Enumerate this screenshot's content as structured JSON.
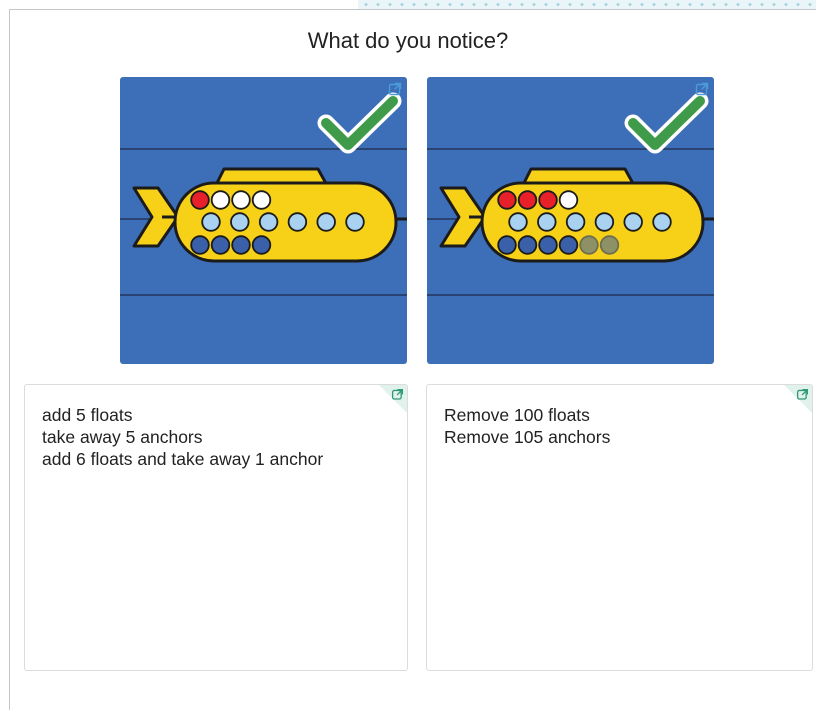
{
  "prompt": {
    "title": "What do you notice?"
  },
  "colors": {
    "card_background": "#3d6eb8",
    "submarine_body": "#f7d117",
    "float_red": "#e8202a",
    "float_white": "#ffffff",
    "porthole": "#a9d2f0",
    "anchor_blue": "#3960a8",
    "anchor_faded": "#8e9065",
    "checkmark": "#3f9b49"
  },
  "images": [
    {
      "name": "submarine-1",
      "icon": "checkmark-icon",
      "floats": [
        "red",
        "white",
        "white",
        "white"
      ],
      "portholes": 6,
      "anchors": [
        "blue",
        "blue",
        "blue",
        "blue"
      ]
    },
    {
      "name": "submarine-2",
      "icon": "checkmark-icon",
      "floats": [
        "red",
        "red",
        "red",
        "white"
      ],
      "portholes": 6,
      "anchors": [
        "blue",
        "blue",
        "blue",
        "blue",
        "faded",
        "faded"
      ]
    }
  ],
  "responses": [
    {
      "lines": [
        "add 5 floats",
        "take away 5 anchors",
        "add 6 floats and take away 1 anchor"
      ]
    },
    {
      "lines": [
        "Remove 100 floats",
        "Remove 105 anchors"
      ]
    }
  ]
}
